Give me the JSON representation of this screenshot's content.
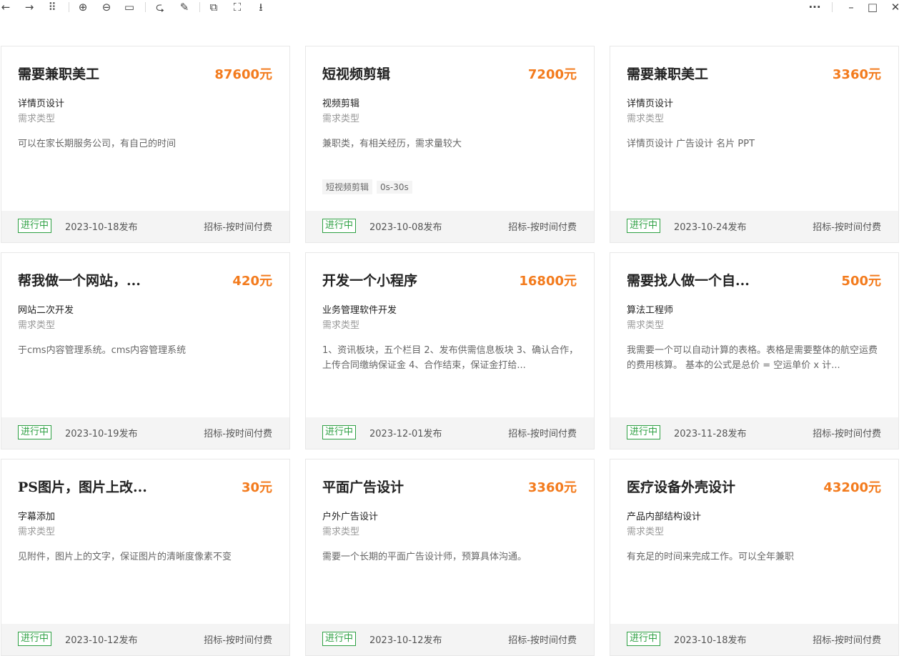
{
  "toolbar": {
    "left_icons": [
      {
        "name": "back-arrow-icon",
        "glyph": "←"
      },
      {
        "name": "forward-arrow-icon",
        "glyph": "→"
      },
      {
        "name": "grid-view-icon",
        "glyph": "⠿"
      },
      {
        "name": "zoom-in-icon",
        "glyph": "⊕"
      },
      {
        "name": "zoom-out-icon",
        "glyph": "⊖"
      },
      {
        "name": "actual-size-icon",
        "glyph": "▭"
      },
      {
        "name": "rotate-icon",
        "glyph": "⮎"
      },
      {
        "name": "edit-icon",
        "glyph": "✎"
      },
      {
        "name": "copy-icon",
        "glyph": "⧉"
      },
      {
        "name": "screenshot-icon",
        "glyph": "⛶"
      },
      {
        "name": "download-icon",
        "glyph": "⭳"
      }
    ],
    "right_icons": [
      {
        "name": "more-icon",
        "glyph": "···"
      },
      {
        "name": "minimize-icon",
        "glyph": "–"
      },
      {
        "name": "maximize-icon",
        "glyph": "□"
      },
      {
        "name": "close-icon",
        "glyph": "✕"
      }
    ]
  },
  "cards": [
    {
      "title": "需要兼职美工",
      "price": "87600元",
      "category": "详情页设计",
      "type_label": "需求类型",
      "desc": "可以在家长期服务公司，有自己的时间",
      "tags": [],
      "status": "进行中",
      "date": "2023-10-18发布",
      "mode": "招标-按时间付费"
    },
    {
      "title": "短视频剪辑",
      "price": "7200元",
      "category": "视频剪辑",
      "type_label": "需求类型",
      "desc": "兼职类，有相关经历，需求量较大",
      "tags": [
        "短视频剪辑",
        "0s-30s"
      ],
      "status": "进行中",
      "date": "2023-10-08发布",
      "mode": "招标-按时间付费"
    },
    {
      "title": "需要兼职美工",
      "price": "3360元",
      "category": "详情页设计",
      "type_label": "需求类型",
      "desc": "详情页设计 广告设计 名片 PPT",
      "tags": [],
      "status": "进行中",
      "date": "2023-10-24发布",
      "mode": "招标-按时间付费"
    },
    {
      "title": "帮我做一个网站，...",
      "price": "420元",
      "category": "网站二次开发",
      "type_label": "需求类型",
      "desc": "于cms内容管理系统。cms内容管理系统",
      "tags": [],
      "status": "进行中",
      "date": "2023-10-19发布",
      "mode": "招标-按时间付费"
    },
    {
      "title": "开发一个小程序",
      "price": "16800元",
      "category": "业务管理软件开发",
      "type_label": "需求类型",
      "desc": "1、资讯板块，五个栏目 2、发布供需信息板块 3、确认合作，上传合同缴纳保证金 4、合作结束，保证金打给...",
      "tags": [],
      "status": "进行中",
      "date": "2023-12-01发布",
      "mode": "招标-按时间付费"
    },
    {
      "title": "需要找人做一个自...",
      "price": "500元",
      "category": "算法工程师",
      "type_label": "需求类型",
      "desc": "我需要一个可以自动计算的表格。表格是需要整体的航空运费的费用核算。 基本的公式是总价 = 空运单价 x 计...",
      "tags": [],
      "status": "进行中",
      "date": "2023-11-28发布",
      "mode": "招标-按时间付费"
    },
    {
      "title": "PS图片，图片上改...",
      "price": "30元",
      "category": "字幕添加",
      "type_label": "需求类型",
      "desc": "见附件，图片上的文字，保证图片的清晰度像素不变",
      "tags": [],
      "status": "进行中",
      "date": "2023-10-12发布",
      "mode": "招标-按时间付费"
    },
    {
      "title": "平面广告设计",
      "price": "3360元",
      "category": "户外广告设计",
      "type_label": "需求类型",
      "desc": "需要一个长期的平面广告设计师，预算具体沟通。",
      "tags": [],
      "status": "进行中",
      "date": "2023-10-12发布",
      "mode": "招标-按时间付费"
    },
    {
      "title": "医疗设备外壳设计",
      "price": "43200元",
      "category": "产品内部结构设计",
      "type_label": "需求类型",
      "desc": "有充足的时间来完成工作。可以全年兼职",
      "tags": [],
      "status": "进行中",
      "date": "2023-10-18发布",
      "mode": "招标-按时间付费"
    }
  ]
}
